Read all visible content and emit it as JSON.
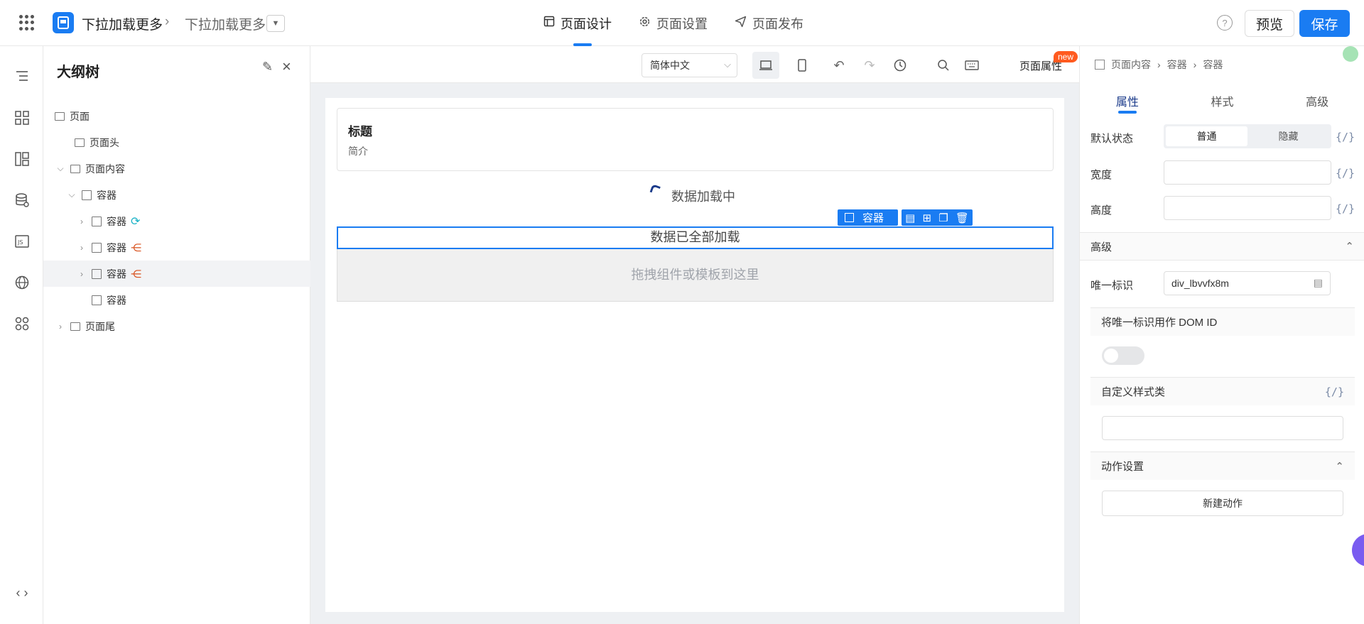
{
  "topbar": {
    "crumb1": "下拉加载更多",
    "crumb2": "下拉加载更多",
    "tabs": [
      {
        "label": "页面设计",
        "icon": "layout-icon"
      },
      {
        "label": "页面设置",
        "icon": "gear-icon"
      },
      {
        "label": "页面发布",
        "icon": "send-icon"
      }
    ],
    "help": "?",
    "preview": "预览",
    "save": "保存"
  },
  "outline": {
    "title": "大纲树",
    "tree": [
      {
        "label": "页面"
      },
      {
        "label": "页面头"
      },
      {
        "label": "页面内容"
      },
      {
        "label": "容器"
      },
      {
        "label": "容器"
      },
      {
        "label": "容器"
      },
      {
        "label": "容器"
      },
      {
        "label": "容器"
      },
      {
        "label": "页面尾"
      }
    ]
  },
  "canvas": {
    "lang": "简体中文",
    "page_prop": "页面属性",
    "new_badge": "new",
    "header_title": "标题",
    "header_sub": "简介",
    "loading": "数据加载中",
    "loaded": "数据已全部加载",
    "drop_hint": "拖拽组件或模板到这里",
    "sel_tag": "容器"
  },
  "rpanel": {
    "crumb": [
      "页面内容",
      "容器",
      "容器"
    ],
    "tabs": [
      "属性",
      "样式",
      "高级"
    ],
    "default_state_label": "默认状态",
    "state_normal": "普通",
    "state_hidden": "隐藏",
    "width_label": "宽度",
    "height_label": "高度",
    "fx": "{/}",
    "adv_section": "高级",
    "uid_label": "唯一标识",
    "uid_value": "div_lbvvfx8m",
    "dom_id_label": "将唯一标识用作 DOM ID",
    "custom_class_label": "自定义样式类",
    "action_section": "动作设置",
    "new_action": "新建动作"
  }
}
